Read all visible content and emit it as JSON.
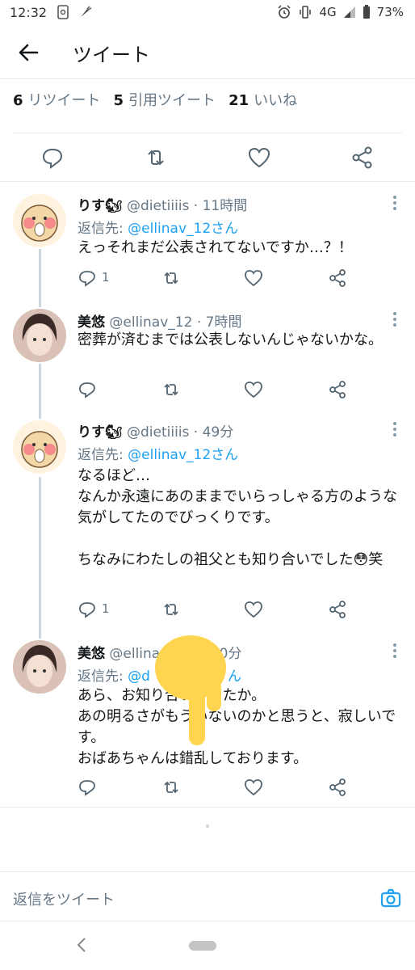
{
  "status_bar": {
    "time": "12:32",
    "network": "4G",
    "battery": "73%"
  },
  "header": {
    "title": "ツイート"
  },
  "stats": {
    "retweets_count": "6",
    "retweets_label": "リツイート",
    "quotes_count": "5",
    "quotes_label": "引用ツイート",
    "likes_count": "21",
    "likes_label": "いいね"
  },
  "tweets": [
    {
      "name": "りす🐿",
      "handle": "@dietiiiis",
      "time": "· 11時間",
      "reply_prefix": "返信先: ",
      "reply_to": "@ellinav_12さん",
      "body": "えっそれまだ公表されてないですか…？！",
      "reply_count": "1"
    },
    {
      "name": "美悠",
      "handle": "@ellinav_12",
      "time": "· 7時間",
      "body": "密葬が済むまでは公表しないんじゃないかな。",
      "reply_count": ""
    },
    {
      "name": "りす🐿",
      "handle": "@dietiiiis",
      "time": "· 49分",
      "reply_prefix": "返信先: ",
      "reply_to": "@ellinav_12さん",
      "body": "なるほど…\nなんか永遠にあのままでいらっしゃる方のような気がしてたのでびっくりです。\n\nちなみにわたしの祖父とも知り合いでした😳笑",
      "reply_count": "1"
    },
    {
      "name": "美悠",
      "handle": "@ellina",
      "time": "0分",
      "reply_prefix": "返信先: ",
      "reply_to": "@d",
      "reply_to_tail": "ん",
      "body": "あら、お知り合いでしたか。\nあの明るさがもういないのかと思うと、寂しいです。\nおばあちゃんは錯乱しております。",
      "reply_count": ""
    }
  ],
  "reply_bar": {
    "placeholder": "返信をツイート"
  },
  "colors": {
    "accent": "#1da1f2",
    "secondary_text": "#657786",
    "finger_overlay": "#ffd54f"
  }
}
